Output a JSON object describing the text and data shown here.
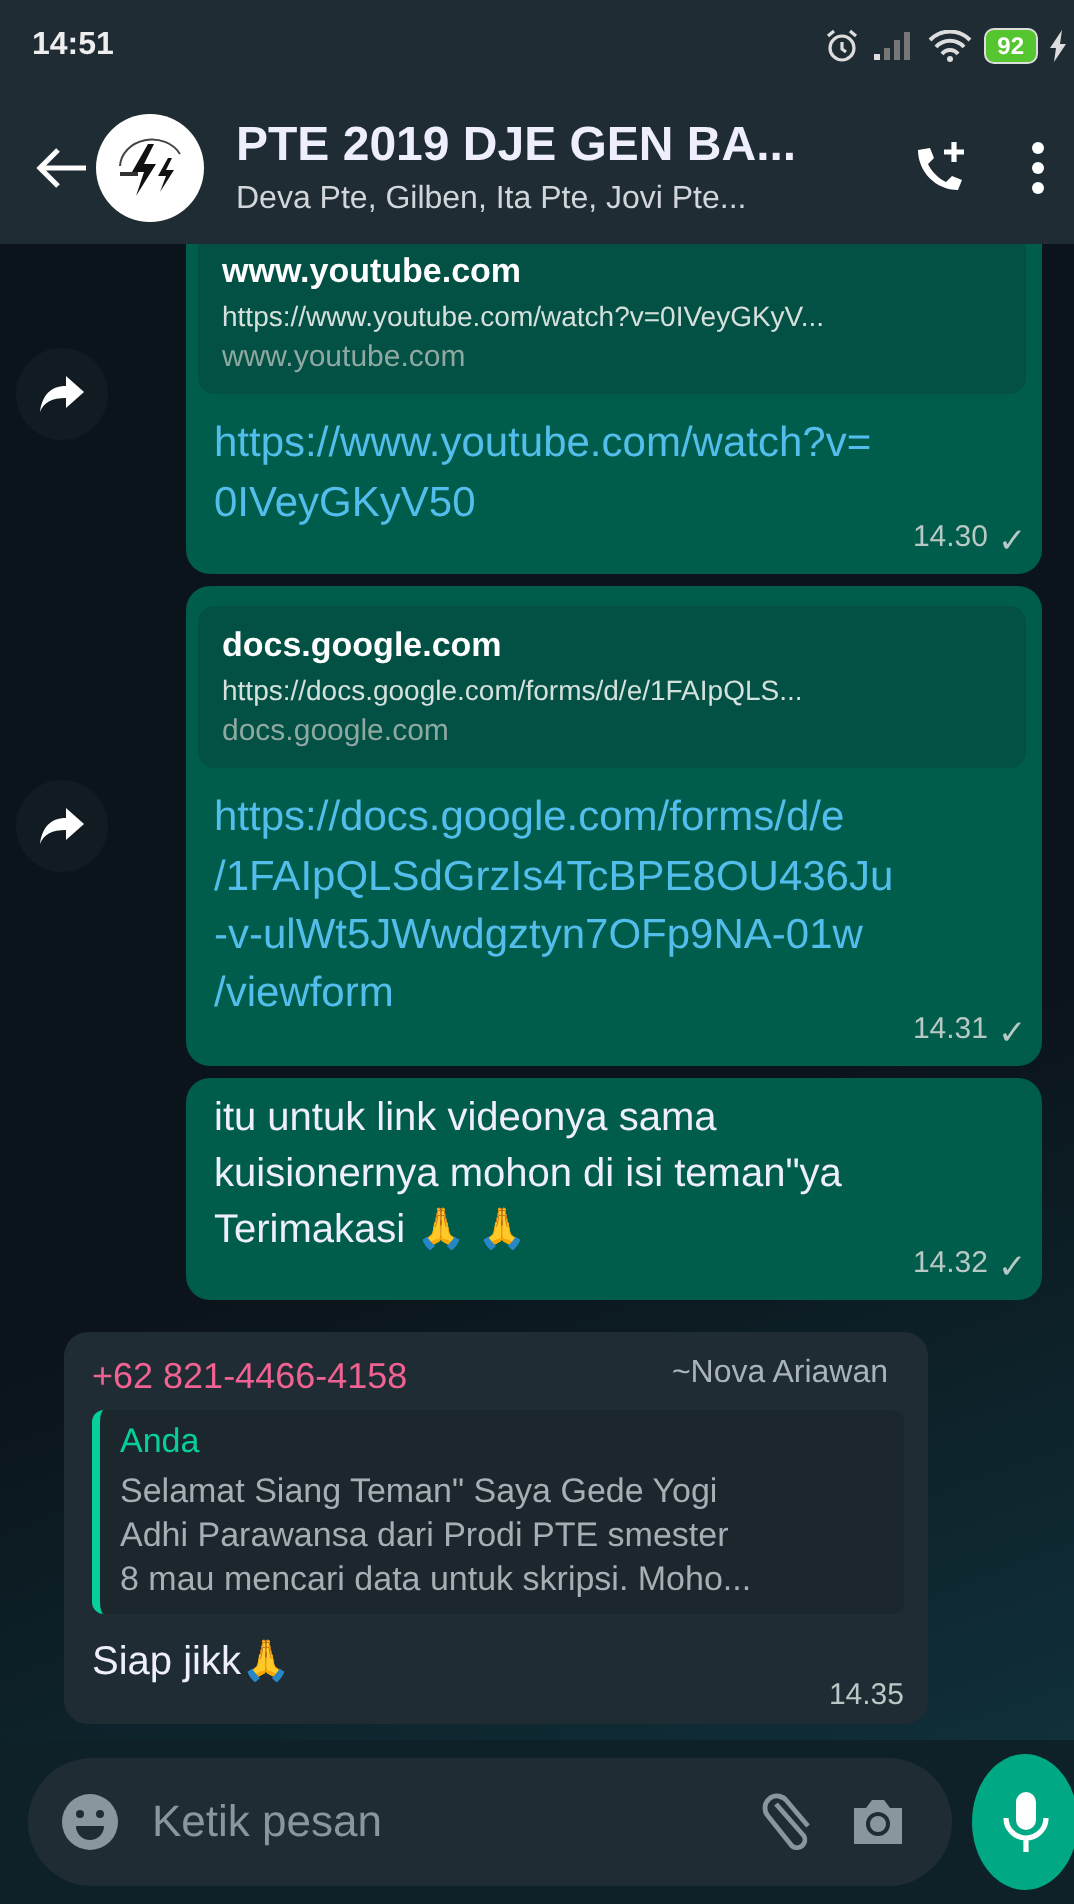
{
  "status_bar": {
    "time": "14:51",
    "battery": "92"
  },
  "header": {
    "title": "PTE 2019 DJE GEN BA...",
    "subtitle": "Deva Pte, Gilben, Ita Pte, Jovi Pte..."
  },
  "messages": [
    {
      "kind": "link",
      "forward": true,
      "preview_title": "www.youtube.com",
      "preview_url": "https://www.youtube.com/watch?v=0IVeyGKyV...",
      "preview_site": "www.youtube.com",
      "text": "https://www.youtube.com/watch?v=\n0IVeyGKyV50",
      "time": "14.30",
      "tick": "✓"
    },
    {
      "kind": "link",
      "forward": true,
      "preview_title": "docs.google.com",
      "preview_url": "https://docs.google.com/forms/d/e/1FAIpQLS...",
      "preview_site": "docs.google.com",
      "text": "https://docs.google.com/forms/d/e\n/1FAIpQLSdGrzIs4TcBPE8OU436Ju\n-v-ulWt5JWwdgztyn7OFp9NA-01w\n/viewform",
      "time": "14.31",
      "tick": "✓"
    },
    {
      "kind": "text",
      "forward": false,
      "text": "itu untuk link videonya sama\nkuisionernya mohon di isi teman\"ya\nTerimakasi 🙏 🙏",
      "time": "14.32",
      "tick": "✓"
    },
    {
      "kind": "reply",
      "forward": false,
      "sender": "+62 821-4466-4158",
      "sender_name": "~Nova Ariawan",
      "quote_author": "Anda",
      "quote_text": "Selamat Siang Teman\" Saya Gede Yogi\nAdhi Parawansa dari Prodi PTE smester\n8 mau mencari data untuk skripsi. Moho...",
      "text": "Siap jikk🙏",
      "time": "14.35"
    }
  ],
  "input": {
    "placeholder": "Ketik pesan"
  }
}
